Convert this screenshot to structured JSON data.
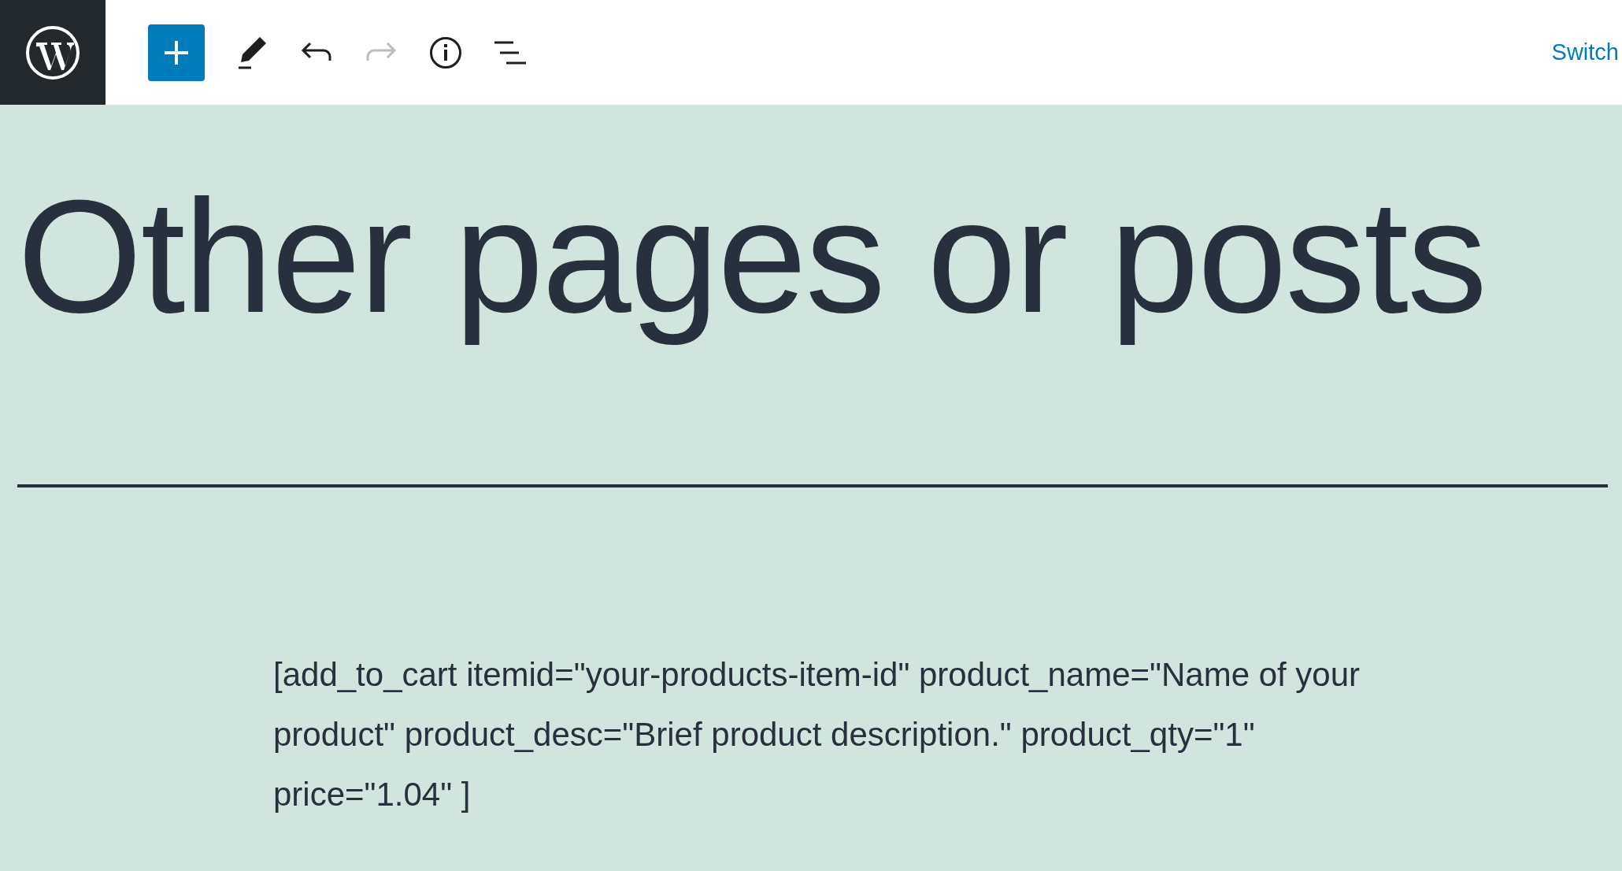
{
  "toolbar": {
    "switch_link": "Switch",
    "redo_disabled": true
  },
  "heading": "Other pages or posts",
  "paragraph": "[add_to_cart itemid=\"your-products-item-id\" product_name=\"Name of your product\" product_desc=\"Brief product description.\" product_qty=\"1\" price=\"1.04\" ]"
}
